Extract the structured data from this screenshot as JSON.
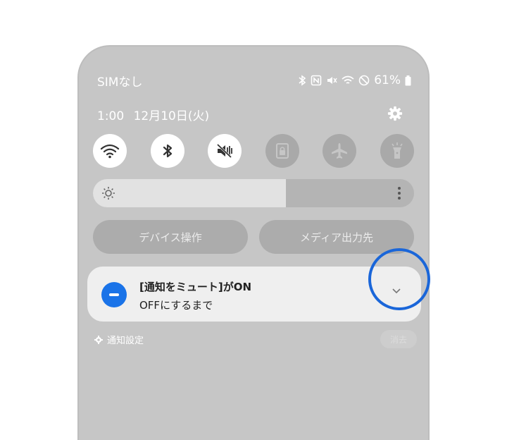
{
  "status_bar": {
    "carrier": "SIMなし",
    "battery": "61%",
    "icons": [
      "bluetooth-icon",
      "nfc-icon",
      "mute-icon",
      "wifi-icon",
      "dnd-icon",
      "battery-icon"
    ]
  },
  "header": {
    "time": "1:00",
    "date": "12月10日(火)"
  },
  "quick_settings": [
    {
      "name": "wifi",
      "state": "on"
    },
    {
      "name": "bluetooth",
      "state": "on"
    },
    {
      "name": "mute",
      "state": "on"
    },
    {
      "name": "screen-lock",
      "state": "off"
    },
    {
      "name": "airplane-mode",
      "state": "off"
    },
    {
      "name": "flashlight",
      "state": "off"
    }
  ],
  "brightness": {
    "level": 0.6
  },
  "buttons": {
    "device_control": "デバイス操作",
    "media_output": "メディア出力先"
  },
  "notification": {
    "title": "[通知をミュート]がON",
    "body": "OFFにするまで",
    "icon_color": "#1a73e8"
  },
  "footer": {
    "settings_label": "通知設定",
    "clear_label": "消去"
  },
  "colors": {
    "highlight": "#1a66d9",
    "panel": "#c6c6c6"
  }
}
